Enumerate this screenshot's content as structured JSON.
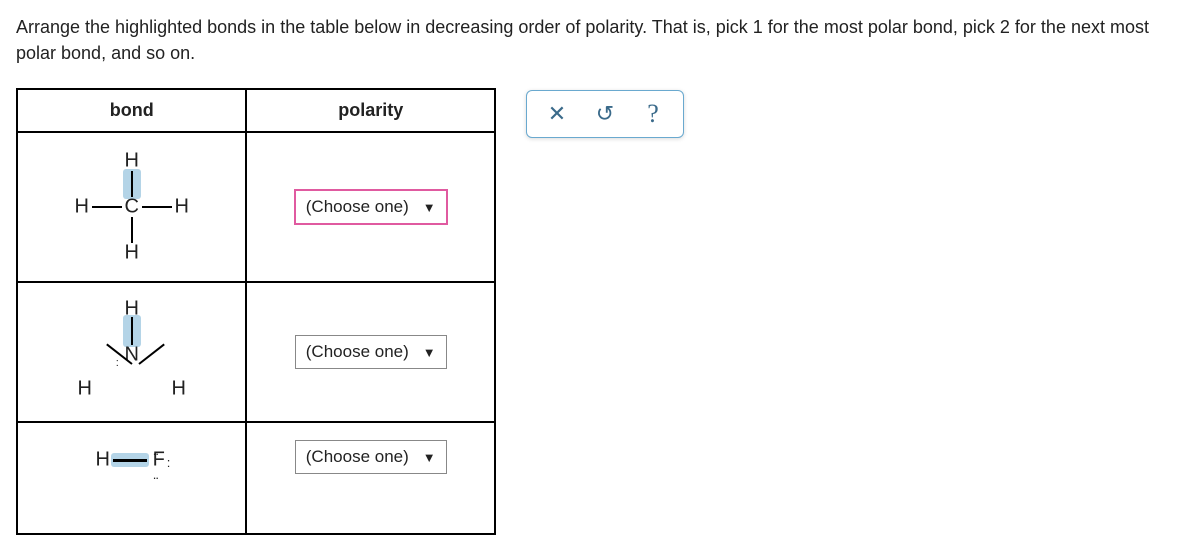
{
  "instructions": "Arrange the highlighted bonds in the table below in decreasing order of polarity. That is, pick 1 for the most polar bond, pick 2 for the next most polar bond, and so on.",
  "headers": {
    "bond": "bond",
    "polarity": "polarity"
  },
  "rows": [
    {
      "molecule": {
        "type": "CH4",
        "atoms": {
          "C": "C",
          "Ht": "H",
          "Hb": "H",
          "Hl": "H",
          "Hr": "H"
        },
        "highlighted_bond": "C-H(top)"
      },
      "dropdown": {
        "label": "(Choose one)",
        "focused": true
      }
    },
    {
      "molecule": {
        "type": "NH3",
        "atoms": {
          "N": "N",
          "Ht": "H",
          "Hl": "H",
          "Hr": "H"
        },
        "lone_pair": ":",
        "highlighted_bond": "N-H(top)"
      },
      "dropdown": {
        "label": "(Choose one)",
        "focused": false
      }
    },
    {
      "molecule": {
        "type": "HF",
        "atoms": {
          "H": "H",
          "F": "F"
        },
        "lone_pairs": {
          "right": ":",
          "top": "..",
          "bottom": ".."
        },
        "highlighted_bond": "H-F"
      },
      "dropdown": {
        "label": "(Choose one)",
        "focused": false
      }
    }
  ],
  "dropdown_caret": "▼",
  "toolbar": {
    "close": {
      "glyph": "✕",
      "name": "close"
    },
    "reset": {
      "glyph": "↺",
      "name": "reset"
    },
    "help": {
      "glyph": "?",
      "name": "help"
    }
  }
}
